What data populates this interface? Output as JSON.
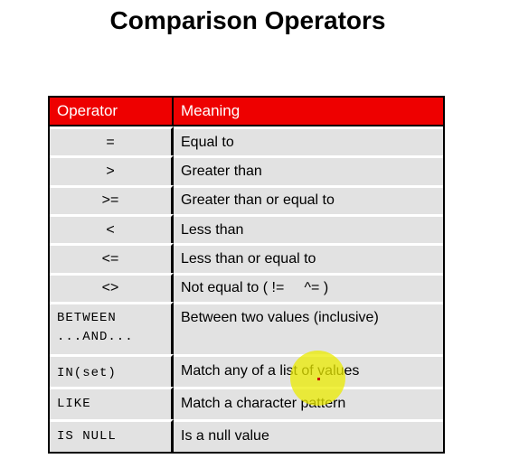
{
  "title": "Comparison Operators",
  "table": {
    "headers": {
      "operator": "Operator",
      "meaning": "Meaning"
    },
    "rows": [
      {
        "operator": "=",
        "meaning": "Equal to"
      },
      {
        "operator": ">",
        "meaning": "Greater than"
      },
      {
        "operator": ">=",
        "meaning": "Greater than or equal to"
      },
      {
        "operator": "<",
        "meaning": "Less than"
      },
      {
        "operator": "<=",
        "meaning": "Less than or equal to"
      },
      {
        "operator": "<>",
        "meaning": "Not equal to ( !=     ^= )"
      },
      {
        "operator_line1": "BETWEEN",
        "operator_line2": "...AND...",
        "meaning": "Between two values (inclusive)"
      },
      {
        "operator": "IN(set)",
        "meaning": "Match any of a list of values"
      },
      {
        "operator": "LIKE",
        "meaning": "Match a character pattern"
      },
      {
        "operator": "IS NULL",
        "meaning": "Is a null value"
      }
    ]
  },
  "colors": {
    "header_bg": "#ee0000",
    "cell_bg": "#e2e2e2",
    "cursor_highlight": "#ebeb00"
  }
}
